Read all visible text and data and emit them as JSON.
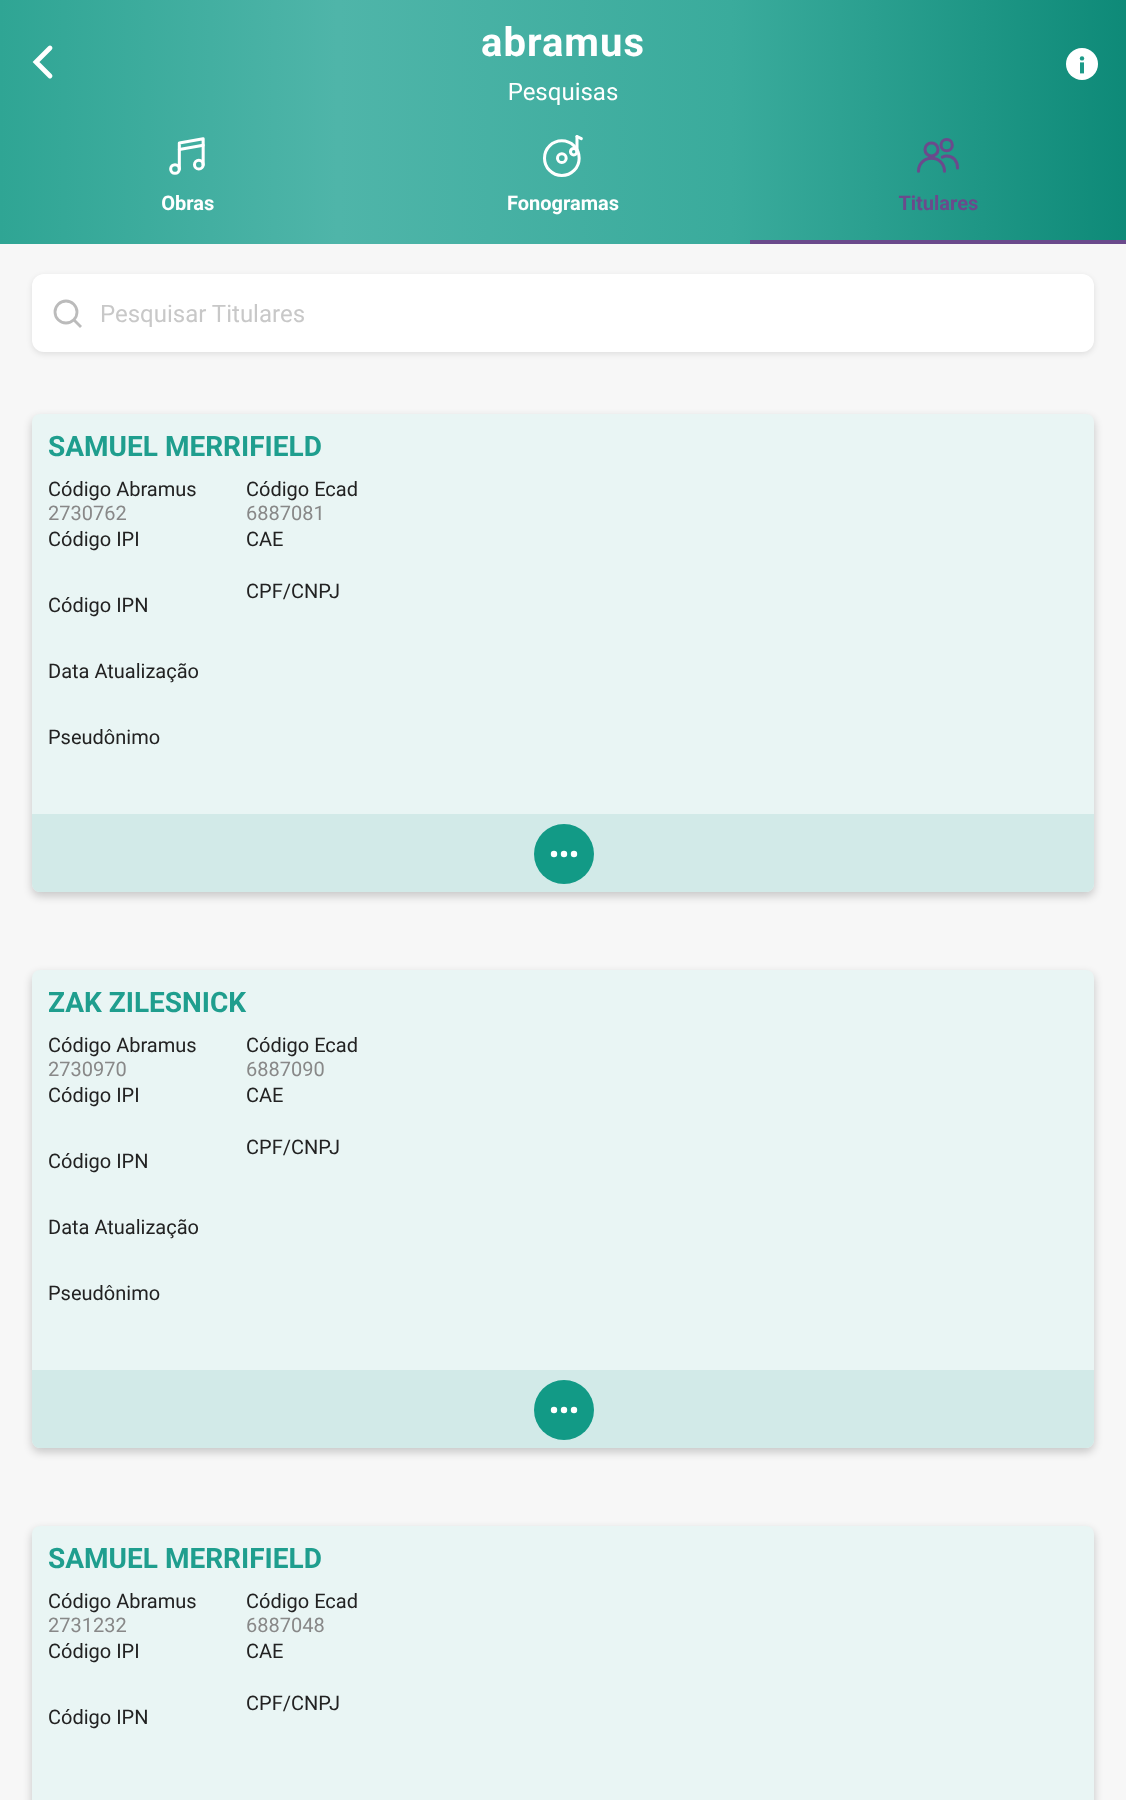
{
  "header": {
    "logo": "abramus",
    "title": "Pesquisas"
  },
  "tabs": [
    {
      "label": "Obras",
      "selected": false
    },
    {
      "label": "Fonogramas",
      "selected": false
    },
    {
      "label": "Titulares",
      "selected": true
    }
  ],
  "search": {
    "placeholder": "Pesquisar Titulares"
  },
  "cards": [
    {
      "name": "SAMUEL MERRIFIELD",
      "left_fields": [
        {
          "label": "Código Abramus",
          "value": "2730762"
        },
        {
          "label": "Código IPI"
        },
        {
          "label": "Código IPN"
        },
        {
          "label": "Data Atualização"
        },
        {
          "label": "Pseudônimo"
        }
      ],
      "right_fields": [
        {
          "label": "Código Ecad",
          "value": "6887081"
        },
        {
          "label": "CAE"
        },
        {
          "label": "CPF/CNPJ"
        }
      ],
      "has_more_button": true
    },
    {
      "name": "ZAK ZILESNICK",
      "left_fields": [
        {
          "label": "Código Abramus",
          "value": "2730970"
        },
        {
          "label": "Código IPI"
        },
        {
          "label": "Código IPN"
        },
        {
          "label": "Data Atualização"
        },
        {
          "label": "Pseudônimo"
        }
      ],
      "right_fields": [
        {
          "label": "Código Ecad",
          "value": "6887090"
        },
        {
          "label": "CAE"
        },
        {
          "label": "CPF/CNPJ"
        }
      ],
      "has_more_button": true
    },
    {
      "name": "SAMUEL MERRIFIELD",
      "left_fields": [
        {
          "label": "Código Abramus",
          "value": "2731232"
        },
        {
          "label": "Código IPI"
        },
        {
          "label": "Código IPN"
        }
      ],
      "right_fields": [
        {
          "label": "Código Ecad",
          "value": "6887048"
        },
        {
          "label": "CAE"
        },
        {
          "label": "CPF/CNPJ"
        }
      ],
      "has_more_button": false
    }
  ]
}
